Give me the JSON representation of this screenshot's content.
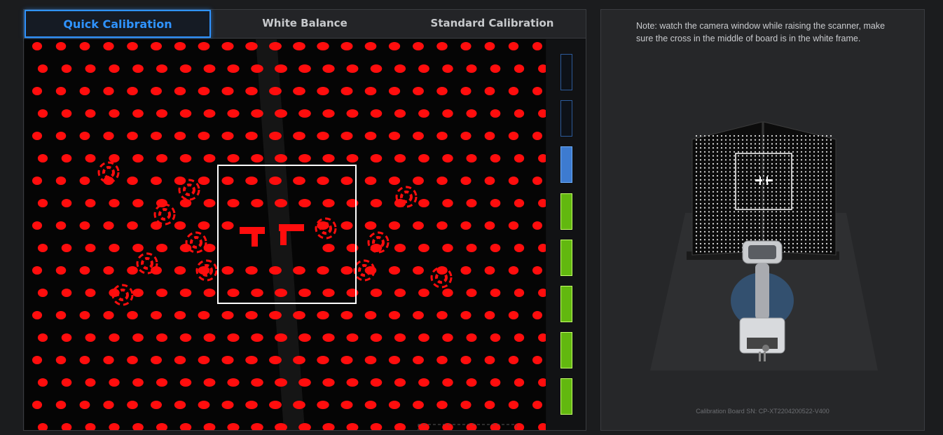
{
  "tabs": [
    {
      "label": "Quick Calibration",
      "active": true
    },
    {
      "label": "White Balance",
      "active": false
    },
    {
      "label": "Standard Calibration",
      "active": false
    }
  ],
  "camera": {
    "target_color": "#ff0d0d",
    "frame_color": "#ffffff"
  },
  "progress_meter": {
    "total_bars": 8,
    "filled_green": 5,
    "current_blue": 1,
    "colors": {
      "empty": "#0d1117",
      "blue": "#3d7bd0",
      "green": "#62b80f"
    }
  },
  "guide": {
    "note": "Note: watch the camera window while raising the scanner, make sure the cross in the middle of board is in the white frame.",
    "board_sn": "Calibration Board SN: CP-XT2204200522-V400"
  }
}
